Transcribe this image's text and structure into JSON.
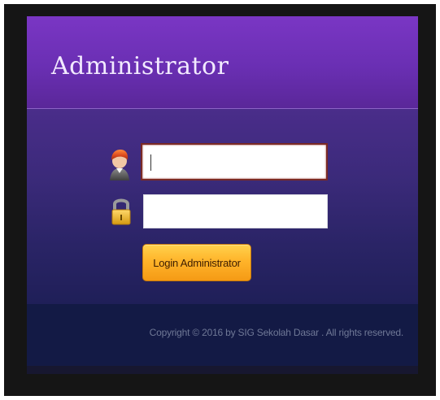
{
  "header": {
    "title": "Administrator"
  },
  "form": {
    "username": {
      "icon": "user-icon",
      "value": "",
      "placeholder": ""
    },
    "password": {
      "icon": "lock-icon",
      "value": "",
      "placeholder": ""
    },
    "login_label": "Login Administrator"
  },
  "footer": {
    "copyright": "Copyright © 2016 by SIG Sekolah Dasar . All rights reserved."
  },
  "colors": {
    "header": "#6a2fb3",
    "body": "#3b2a7a",
    "footer": "#131a45",
    "button": "#ffb42a"
  }
}
